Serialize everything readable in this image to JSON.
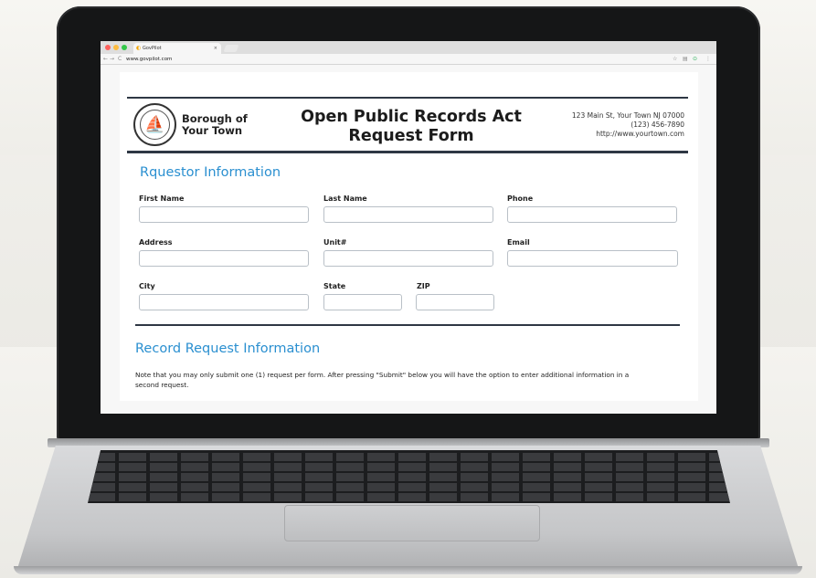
{
  "browser": {
    "tab_title": "GovPilot",
    "tab_close": "×",
    "url": "www.govpilot.com",
    "nav_back": "←",
    "nav_forward": "→",
    "nav_reload": "C",
    "ext_star": "☆",
    "ext_reader": "▤",
    "ext_green": "⊙",
    "ext_menu": "⋮"
  },
  "header": {
    "borough_line1": "Borough of",
    "borough_line2": "Your Town",
    "title_line1": "Open Public Records Act",
    "title_line2": "Request Form",
    "address_line1": "123 Main St, Your Town NJ 07000",
    "address_line2": "(123) 456-7890",
    "address_line3": "http://www.yourtown.com"
  },
  "requestor": {
    "title": "Rquestor Information",
    "first_name": "First Name",
    "last_name": "Last Name",
    "phone": "Phone",
    "address": "Address",
    "unit": "Unit#",
    "email": "Email",
    "city": "City",
    "state": "State",
    "zip": "ZIP"
  },
  "record": {
    "title": "Record Request Information",
    "note_line1": "Note that you may only submit one (1) request per form. After pressing \"Submit\" below you will have the option to enter additional information in a",
    "note_line2": "second request."
  },
  "colors": {
    "accent": "#2a8fd0",
    "rule": "#2e3744"
  }
}
